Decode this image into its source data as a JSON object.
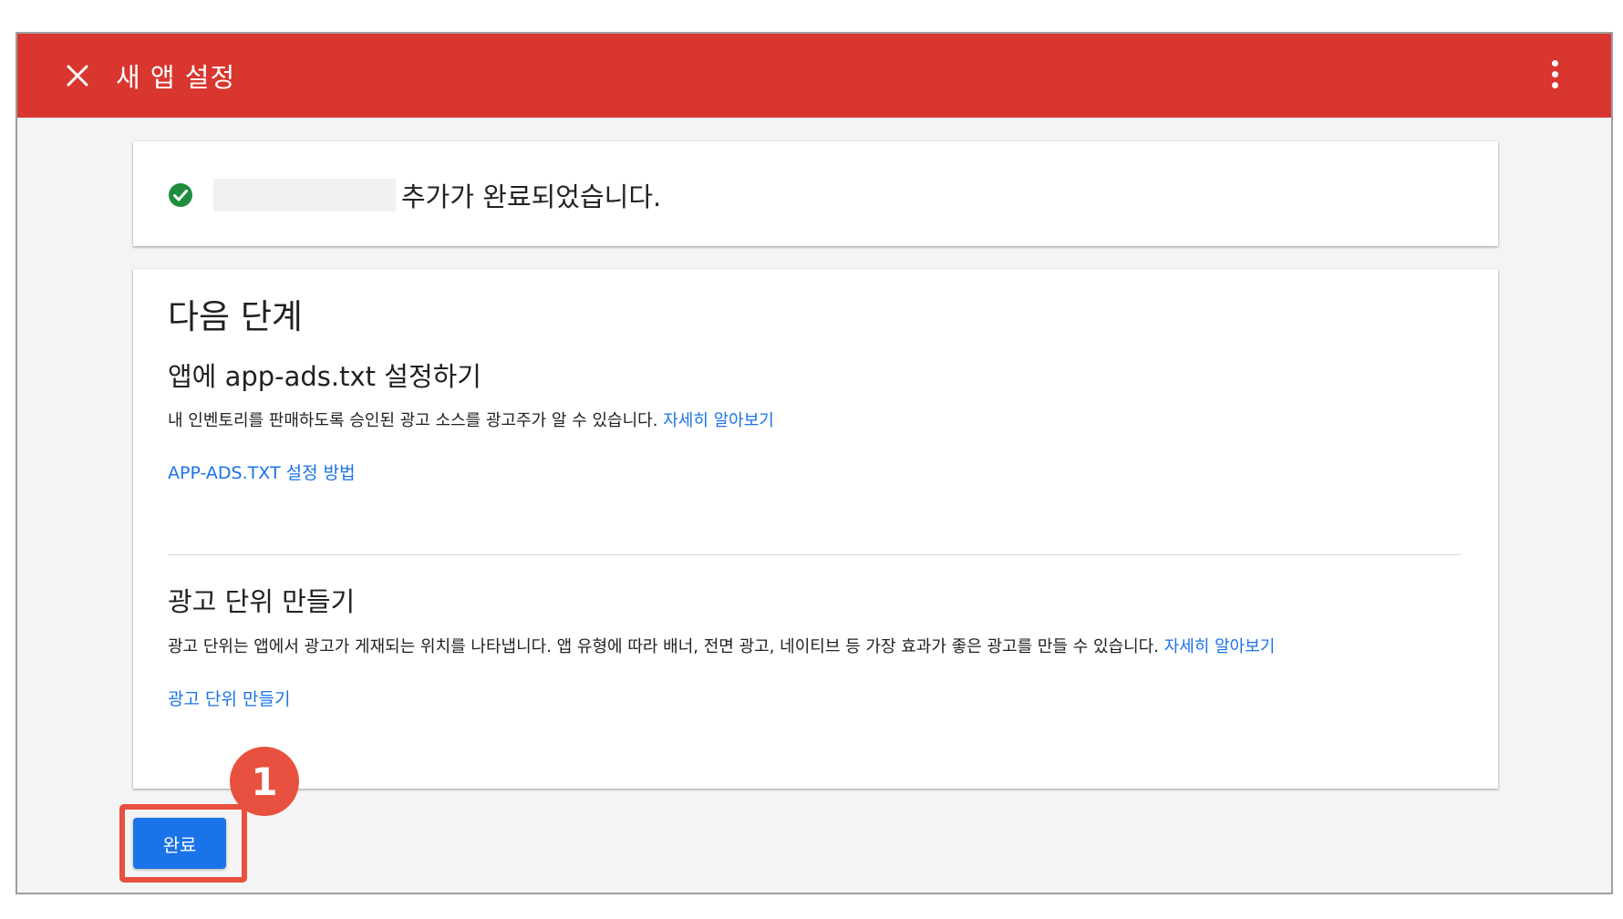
{
  "header": {
    "title": "새 앱 설정",
    "close_icon": "close-icon",
    "more_icon": "more-vert-icon",
    "background_color": "#d93630"
  },
  "success": {
    "icon": "check-circle-icon",
    "icon_color": "#1e8e3e",
    "message": "추가가 완료되었습니다."
  },
  "next_steps": {
    "title": "다음 단계",
    "app_ads": {
      "heading": "앱에 app-ads.txt 설정하기",
      "description": "내 인벤토리를 판매하도록 승인된 광고 소스를 광고주가 알 수 있습니다.",
      "learn_more": "자세히 알아보기",
      "action": "APP-ADS.TXT 설정 방법"
    },
    "ad_units": {
      "heading": "광고 단위 만들기",
      "description": "광고 단위는 앱에서 광고가 게재되는 위치를 나타냅니다. 앱 유형에 따라 배너, 전면 광고, 네이티브 등 가장 효과가 좋은 광고를 만들 수 있습니다.",
      "learn_more": "자세히 알아보기",
      "action": "광고 단위 만들기"
    }
  },
  "footer": {
    "done_label": "완료",
    "step_badge": "1",
    "accent_color": "#1a73e8",
    "highlight_color": "#e8503f"
  }
}
